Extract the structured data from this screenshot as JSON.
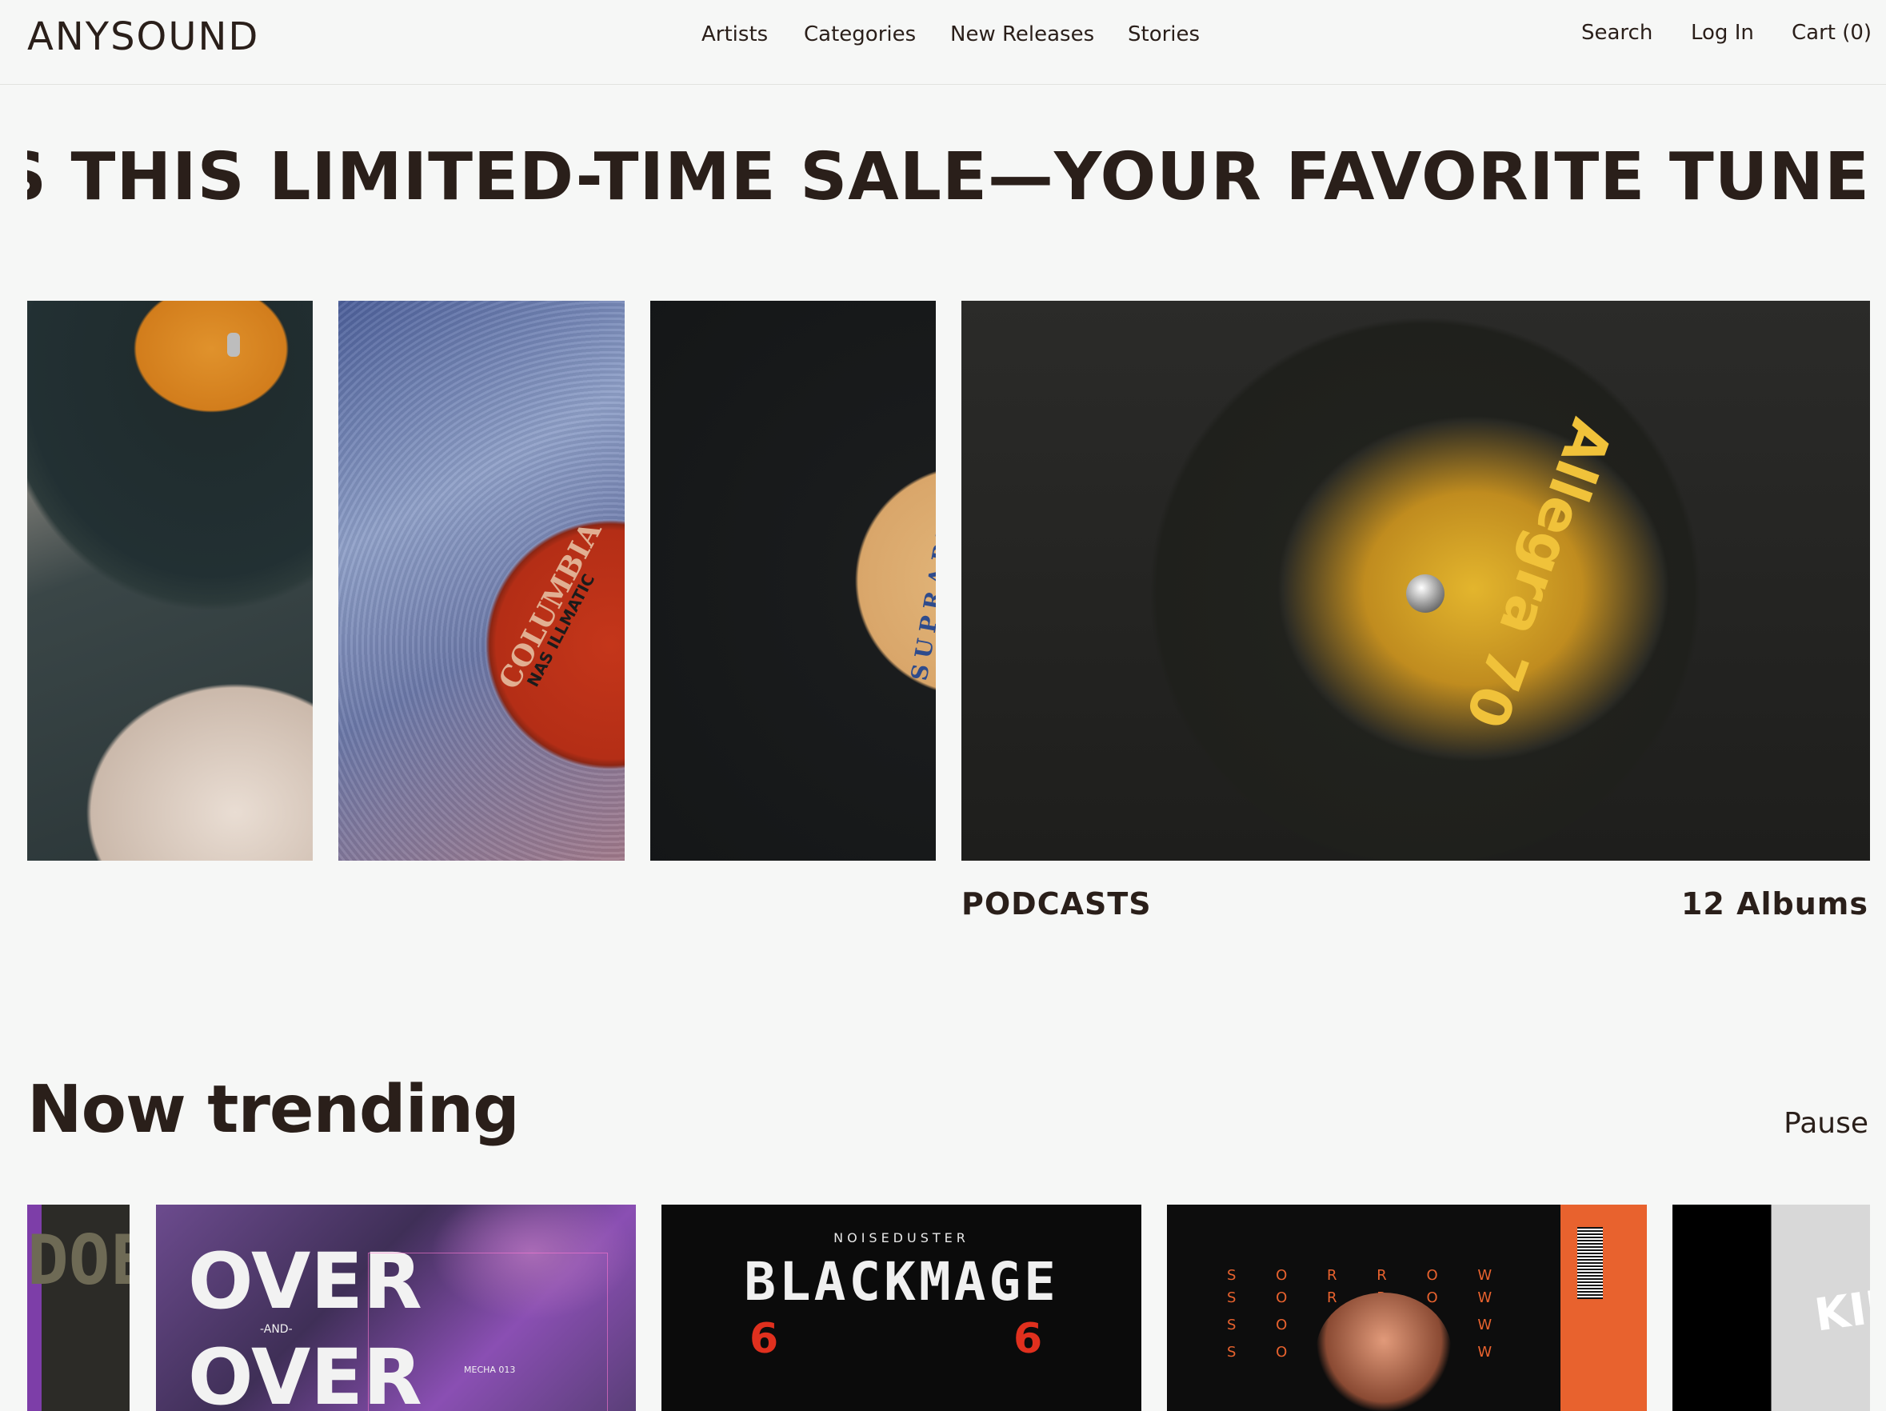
{
  "header": {
    "logo": "ANYSOUND",
    "nav": [
      "Artists",
      "Categories",
      "New Releases",
      "Stories"
    ],
    "search_label": "Search",
    "login_label": "Log In",
    "cart_label": "Cart (0)"
  },
  "marquee": {
    "text": "IISS THIS LIMITED-TIME SALE—YOUR FAVORITE TUNE"
  },
  "gallery": {
    "tiles": [
      {
        "disc_text": ""
      },
      {
        "disc_text": "COLUMBIA",
        "disc_sub": "NAS ILLMATIC"
      },
      {
        "disc_text": "SUPRAPHON"
      },
      {
        "disc_text": "Allegra 70"
      }
    ],
    "featured_caption": "PODCASTS",
    "featured_count": "12 Albums"
  },
  "trending": {
    "title": "Now trending",
    "pause_label": "Pause",
    "albums": [
      {
        "cover_text": "DOE"
      },
      {
        "cover_text": "OVER",
        "cover_sub": "-AND-",
        "cover_text2": "OVER",
        "cover_tag": "MECHA 013"
      },
      {
        "cover_top": "NOISEDUSTER",
        "cover_text": "BLACKMAGE",
        "cover_num": "6"
      },
      {
        "cover_text": "S O R R O W"
      },
      {
        "cover_text": "KIL"
      }
    ]
  }
}
